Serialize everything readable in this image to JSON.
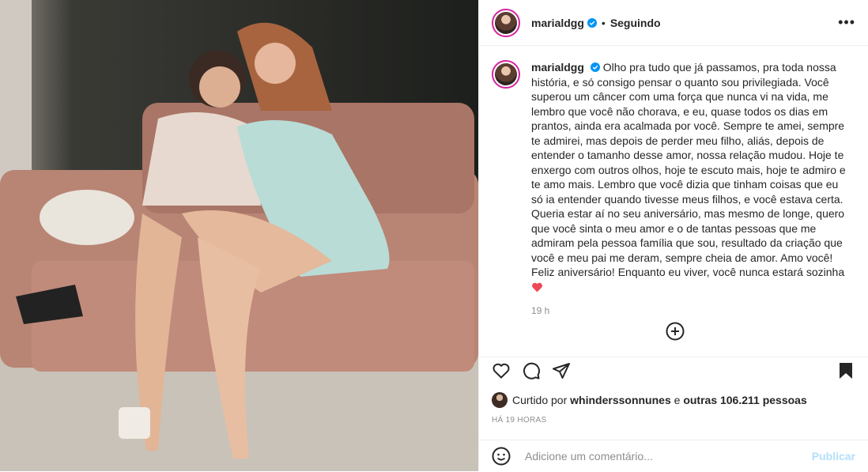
{
  "post": {
    "username": "marialdgg",
    "follow_state": "Seguindo",
    "more_label": "•••",
    "caption_username": "marialdgg",
    "caption_text": "Olho pra tudo que já passamos, pra toda nossa história, e só consigo pensar o quanto sou privilegiada. Você superou um câncer com uma força que nunca vi na vida, me lembro que você não chorava, e eu, quase todos os dias em prantos, ainda era acalmada por você. Sempre te amei, sempre te admirei, mas depois de perder meu filho, aliás, depois de entender o tamanho desse amor, nossa relação mudou. Hoje te enxergo com outros olhos, hoje te escuto mais, hoje te admiro e te amo mais. Lembro que você dizia que tinham coisas que eu só ia entender quando tivesse meus filhos, e você estava certa. Queria estar aí no seu aniversário, mas mesmo de longe, quero que você sinta o meu amor e o de tantas pessoas que me admiram pela pessoa família que sou, resultado da criação que você e meu pai me deram, sempre cheia de amor. Amo você! Feliz aniversário! Enquanto eu viver, você nunca estará sozinha",
    "caption_time": "19 h",
    "likes_prefix": "Curtido por",
    "likes_user": "whinderssonnunes",
    "likes_and": "e",
    "likes_count": "outras 106.211 pessoas",
    "posted_ago": "HÁ 19 HORAS",
    "comment_placeholder": "Adicione um comentário...",
    "publish_label": "Publicar"
  },
  "icons": [
    "verified-icon",
    "more-icon",
    "heart-icon",
    "comment-icon",
    "share-icon",
    "bookmark-icon",
    "add-comment-icon",
    "emoji-icon"
  ],
  "colors": {
    "accent": "#0095f6",
    "publish_disabled": "#b2dffc",
    "heart_red": "#ed4956"
  }
}
